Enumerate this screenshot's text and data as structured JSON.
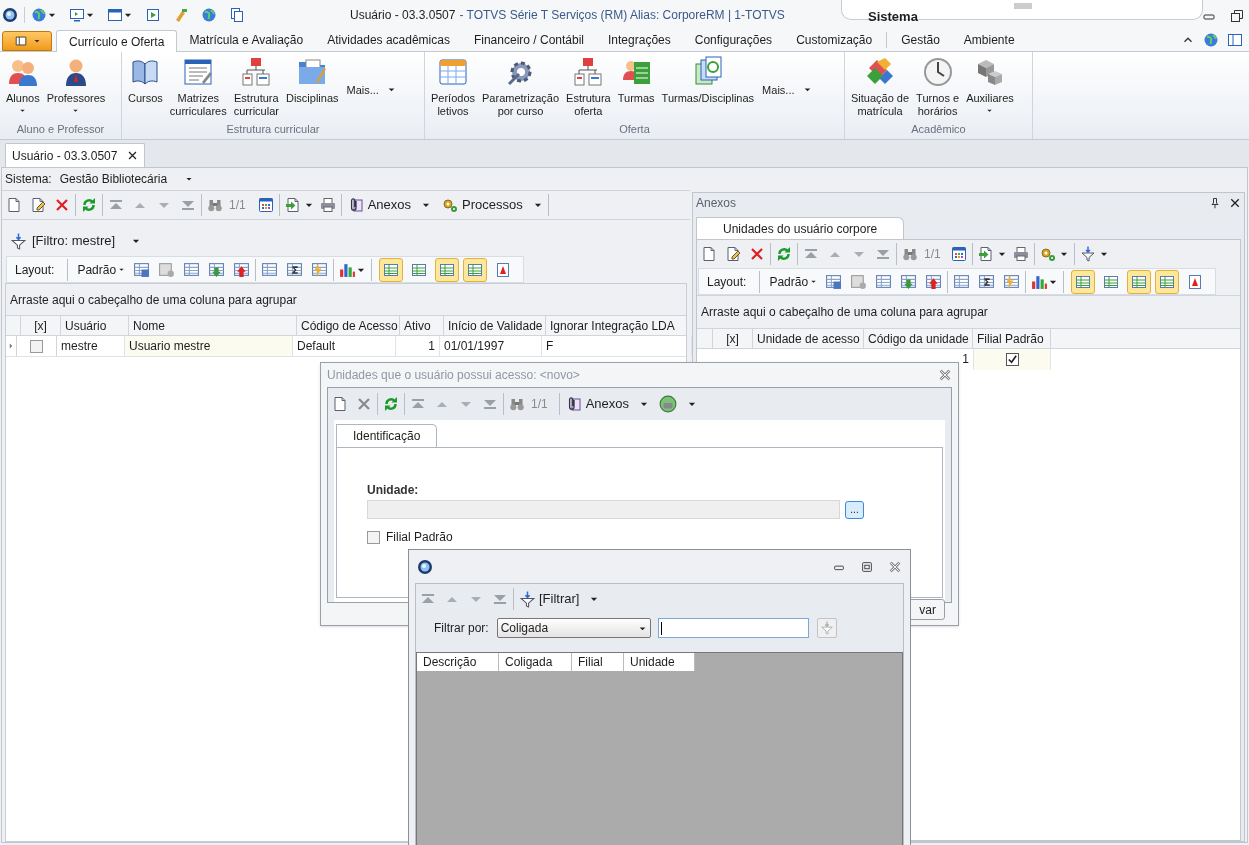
{
  "title_bar": {
    "title": "Usuário - 03.3.0507",
    "subtitle": "- TOTVS Série T Serviços (RM) Alias: CorporeRM | 1-TOTVS",
    "context": "Sistema"
  },
  "ribbon_tabs": [
    {
      "label": "Currículo e Oferta",
      "selected": true
    },
    {
      "label": "Matrícula e Avaliação",
      "selected": false
    },
    {
      "label": "Atividades acadêmicas",
      "selected": false
    },
    {
      "label": "Financeiro / Contábil",
      "selected": false
    },
    {
      "label": "Integrações",
      "selected": false
    },
    {
      "label": "Configurações",
      "selected": false
    },
    {
      "label": "Customização",
      "selected": false
    },
    {
      "label": "Gestão",
      "selected": false
    },
    {
      "label": "Ambiente",
      "selected": false
    }
  ],
  "ribbon_groups": [
    {
      "label": "Aluno e Professor",
      "buttons": [
        {
          "kind": "large",
          "label": "Alunos",
          "dropdown": true
        },
        {
          "kind": "large",
          "label": "Professores",
          "dropdown": true
        }
      ]
    },
    {
      "label": "Estrutura curricular",
      "buttons": [
        {
          "kind": "large",
          "label": "Cursos",
          "dropdown": false
        },
        {
          "kind": "large",
          "label": "Matrizes\ncurriculares",
          "dropdown": false
        },
        {
          "kind": "large",
          "label": "Estrutura\ncurricular",
          "dropdown": false
        },
        {
          "kind": "large",
          "label": "Disciplinas",
          "dropdown": false
        },
        {
          "kind": "more",
          "label": "Mais...",
          "dropdown": true
        }
      ]
    },
    {
      "label": "Oferta",
      "buttons": [
        {
          "kind": "large",
          "label": "Períodos\nletivos",
          "dropdown": false
        },
        {
          "kind": "large",
          "label": "Parametrização\npor curso",
          "dropdown": false
        },
        {
          "kind": "large",
          "label": "Estrutura\noferta",
          "dropdown": false
        },
        {
          "kind": "large",
          "label": "Turmas",
          "dropdown": false
        },
        {
          "kind": "large",
          "label": "Turmas/Disciplinas",
          "dropdown": false
        },
        {
          "kind": "more",
          "label": "Mais...",
          "dropdown": true
        }
      ]
    },
    {
      "label": "Acadêmico",
      "buttons": [
        {
          "kind": "large",
          "label": "Situação de\nmatrícula",
          "dropdown": false
        },
        {
          "kind": "large",
          "label": "Turnos e\nhorários",
          "dropdown": false
        },
        {
          "kind": "large",
          "label": "Auxiliares",
          "dropdown": true
        }
      ]
    }
  ],
  "document_tab": {
    "label": "Usuário - 03.3.0507"
  },
  "system_selector": {
    "label": "Sistema:",
    "value": "Gestão Bibliotecária"
  },
  "main_toolbar": {
    "record_counter": "1/1",
    "attachments": "Anexos",
    "processes": "Processos"
  },
  "filter": {
    "label": "[Filtro: mestre]"
  },
  "layout_bar": {
    "label": "Layout:",
    "preset": "Padrão",
    "toggles": [
      {
        "on": true
      },
      {
        "on": false
      },
      {
        "on": true
      },
      {
        "on": true
      },
      {
        "on": false
      }
    ]
  },
  "group_hint": "Arraste aqui o cabeçalho de uma coluna para agrupar",
  "grid": {
    "checkbox_column": "[x]",
    "columns": [
      "Usuário",
      "Nome",
      "Código de Acesso",
      "Ativo",
      "Início de Validade",
      "Ignorar Integração LDA"
    ],
    "rows": [
      {
        "checked": false,
        "cells": [
          "mestre",
          "Usuario mestre",
          "Default",
          "1",
          "01/01/1997",
          "F"
        ]
      }
    ]
  },
  "attachments_panel": {
    "title": "Anexos",
    "tab": "Unidades do usuário corpore",
    "record_counter": "1/1",
    "layout_bar": {
      "label": "Layout:",
      "preset": "Padrão",
      "toggles": [
        {
          "on": true
        },
        {
          "on": false
        },
        {
          "on": true
        },
        {
          "on": true
        },
        {
          "on": false
        }
      ]
    },
    "group_hint": "Arraste aqui o cabeçalho de uma coluna para agrupar",
    "columns": [
      "[x]",
      "Unidade de acesso",
      "Código da unidade",
      "Filial Padrão"
    ],
    "rows": [
      {
        "unit_code": "1",
        "default_branch": true
      }
    ]
  },
  "unit_dialog": {
    "title": "Unidades que o usuário possui acesso: <novo>",
    "record_counter": "1/1",
    "attachments": "Anexos",
    "tab": "Identificação",
    "field_label": "Unidade:",
    "browse_button": "...",
    "default_branch": {
      "label": "Filial Padrão",
      "checked": false
    },
    "save_button": "var"
  },
  "lookup_dialog": {
    "filter_button": "[Filtrar]",
    "filter_by_label": "Filtrar por:",
    "filter_by_value": "Coligada",
    "columns": [
      "Descrição",
      "Coligada",
      "Filial",
      "Unidade"
    ]
  }
}
